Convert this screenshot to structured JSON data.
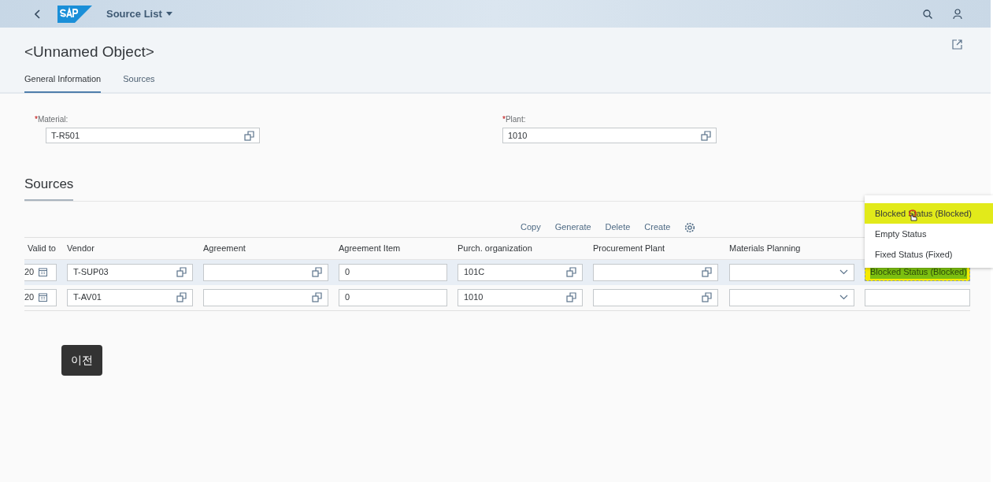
{
  "shell": {
    "title": "Source List"
  },
  "header": {
    "title": "<Unnamed Object>",
    "tabs": [
      {
        "label": "General Information",
        "selected": true
      },
      {
        "label": "Sources",
        "selected": false
      }
    ]
  },
  "fields": [
    {
      "label": "Material:",
      "required_mark": "*",
      "value": "T-R501"
    },
    {
      "label": "Plant:",
      "required_mark": "*",
      "value": "1010"
    }
  ],
  "section_title": "Sources",
  "toolbar": [
    "Copy",
    "Generate",
    "Delete",
    "Create"
  ],
  "table": {
    "columns": [
      "Valid to",
      "Vendor",
      "Agreement",
      "Agreement Item",
      "Purch. organization",
      "Procurement Plant",
      "Materials Planning"
    ],
    "rows": [
      {
        "selected": true,
        "cells": [
          "20",
          "T-SUP03",
          "",
          "0",
          "101C",
          "",
          "",
          "Blocked Status (Blocked)"
        ]
      },
      {
        "selected": false,
        "cells": [
          "20",
          "T-AV01",
          "",
          "0",
          "1010",
          "",
          "",
          ""
        ]
      }
    ]
  },
  "dropdown": [
    {
      "label": "Blocked Status (Blocked)",
      "selected": true
    },
    {
      "label": "Empty Status",
      "selected": false
    },
    {
      "label": "Fixed Status (Fixed)",
      "selected": false
    }
  ],
  "tooltip": "이전"
}
